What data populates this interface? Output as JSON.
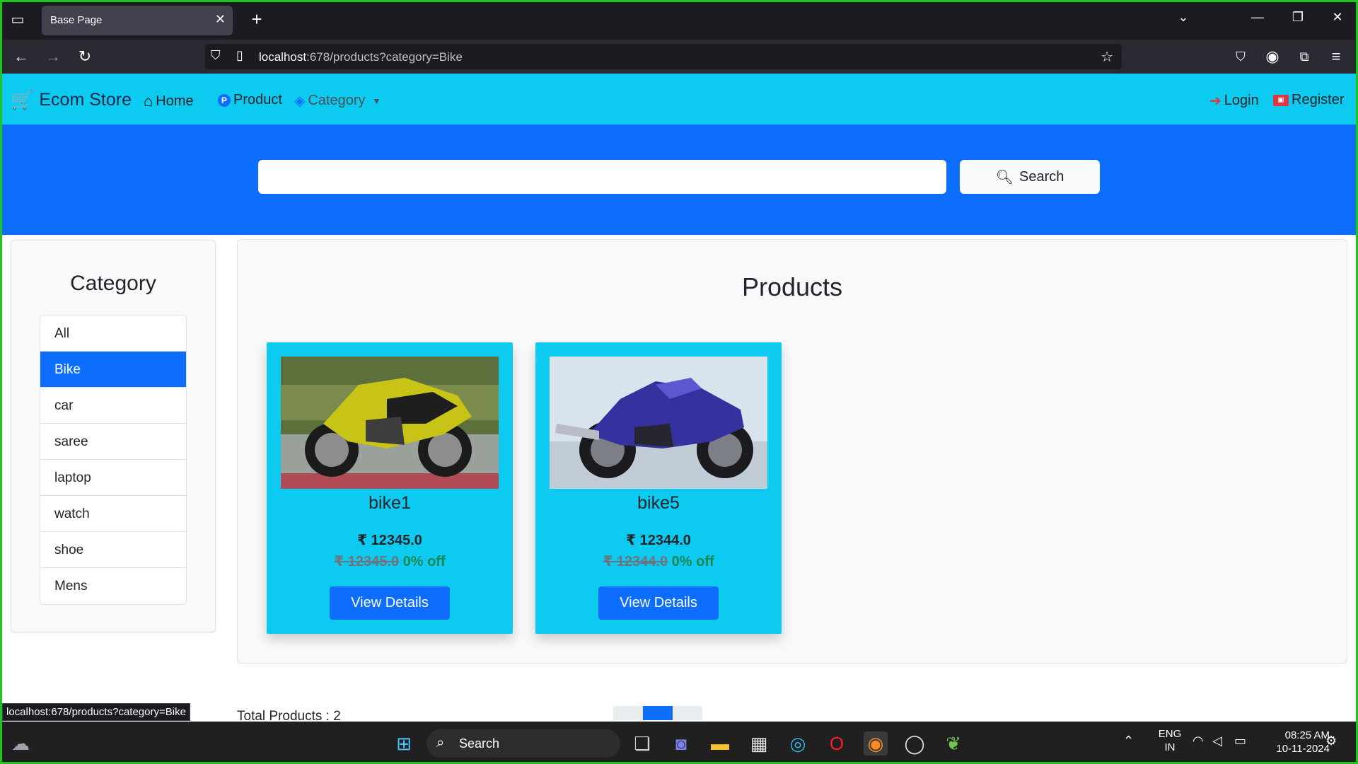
{
  "browser": {
    "tab_title": "Base Page",
    "url_host": "localhost",
    "url_path": ":678/products?category=Bike",
    "status_url": "localhost:678/products?category=Bike"
  },
  "site": {
    "brand": "Ecom Store",
    "nav": {
      "home": "Home",
      "product": "Product",
      "category": "Category",
      "login": "Login",
      "register": "Register"
    }
  },
  "search": {
    "placeholder": "",
    "button": "Search"
  },
  "sidebar": {
    "title": "Category",
    "items": [
      {
        "label": "All",
        "active": false
      },
      {
        "label": "Bike",
        "active": true
      },
      {
        "label": "car",
        "active": false
      },
      {
        "label": "saree",
        "active": false
      },
      {
        "label": "laptop",
        "active": false
      },
      {
        "label": "watch",
        "active": false
      },
      {
        "label": "shoe",
        "active": false
      },
      {
        "label": "Mens",
        "active": false
      }
    ]
  },
  "products": {
    "title": "Products",
    "items": [
      {
        "name": "bike1",
        "price": "₹ 12345.0",
        "original_price": "₹ 12345.0",
        "discount": "0% off",
        "button": "View Details"
      },
      {
        "name": "bike5",
        "price": "₹ 12344.0",
        "original_price": "₹ 12344.0",
        "discount": "0% off",
        "button": "View Details"
      }
    ],
    "total_label": "Total Products : 2"
  },
  "taskbar": {
    "search_label": "Search",
    "lang_line1": "ENG",
    "lang_line2": "IN",
    "time": "08:25 AM",
    "date": "10-11-2024"
  },
  "colors": {
    "navbar": "#0dcaf0",
    "hero": "#0d6efd",
    "primary": "#0d6efd",
    "discount": "#198754"
  }
}
